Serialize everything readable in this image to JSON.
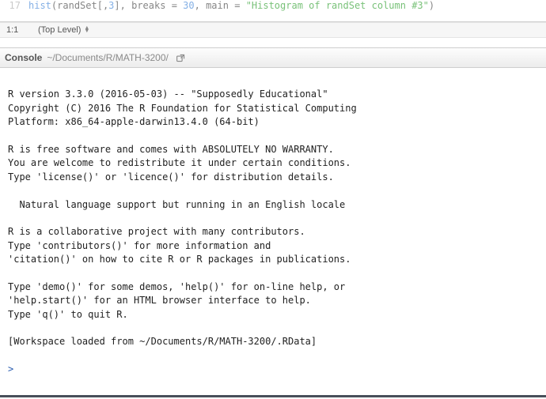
{
  "source": {
    "line_number": "17",
    "code_tokens": {
      "fn": "hist",
      "open": "(",
      "obj": "randSet",
      "idx_open": "[,",
      "idx": "3",
      "idx_close": "],",
      "arg1_name": "breaks",
      "eq": "=",
      "arg1_val": "30",
      "comma": ",",
      "arg2_name": "main",
      "eq2": "=",
      "arg2_val": "\"Histogram of randSet column #3\"",
      "close": ")"
    }
  },
  "status_bar": {
    "cursor_position": "1:1",
    "scope_label": "(Top Level)"
  },
  "console": {
    "title": "Console",
    "path": "~/Documents/R/MATH-3200/",
    "popout_icon": "popout-icon",
    "startup_text": "\nR version 3.3.0 (2016-05-03) -- \"Supposedly Educational\"\nCopyright (C) 2016 The R Foundation for Statistical Computing\nPlatform: x86_64-apple-darwin13.4.0 (64-bit)\n\nR is free software and comes with ABSOLUTELY NO WARRANTY.\nYou are welcome to redistribute it under certain conditions.\nType 'license()' or 'licence()' for distribution details.\n\n  Natural language support but running in an English locale\n\nR is a collaborative project with many contributors.\nType 'contributors()' for more information and\n'citation()' on how to cite R or R packages in publications.\n\nType 'demo()' for some demos, 'help()' for on-line help, or\n'help.start()' for an HTML browser interface to help.\nType 'q()' to quit R.\n\n[Workspace loaded from ~/Documents/R/MATH-3200/.RData]\n",
    "prompt": ">"
  }
}
